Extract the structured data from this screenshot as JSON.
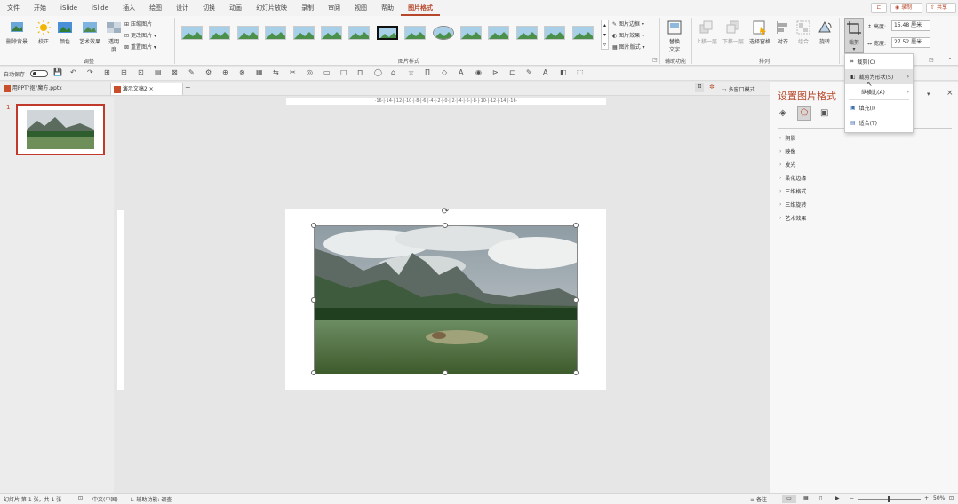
{
  "menu_tabs": [
    "文件",
    "开始",
    "iSlide",
    "iSlide",
    "插入",
    "绘图",
    "设计",
    "切换",
    "动画",
    "幻灯片放映",
    "录制",
    "审阅",
    "视图",
    "帮助",
    "图片格式"
  ],
  "top_right": {
    "comment": "",
    "record": "录制",
    "share": "共享"
  },
  "ribbon": {
    "remove_bg": "删除背景",
    "correct": "校正",
    "color": "颜色",
    "art_effects": "艺术效果",
    "transparency_line1": "透明",
    "transparency_line2": "度",
    "compress": "压缩图片",
    "change_pic": "更改图片",
    "reset_pic": "重置图片",
    "group_adjust": "调整",
    "group_styles": "图片样式",
    "pic_border": "图片边框",
    "pic_effects": "图片效果",
    "pic_layout": "图片版式",
    "alt_text_line1": "替换",
    "alt_text_line2": "文字",
    "group_accessibility": "辅助功能",
    "bring_forward": "上移一层",
    "send_backward": "下移一层",
    "selection_pane": "选择窗格",
    "align": "对齐",
    "group": "组合",
    "rotate": "旋转",
    "group_arrange": "排列",
    "crop": "裁剪",
    "height_label": "高度:",
    "height_value": "15.48 厘米",
    "width_label": "宽度:",
    "width_value": "27.52 厘米"
  },
  "autosave": "自动保存",
  "doc_tabs": [
    "用PPT\"抠\"魔方.pptx",
    "演示文稿2"
  ],
  "multi_window": "多窗口模式",
  "crop_menu": {
    "items": [
      "裁剪(C)",
      "裁剪为形状(S)",
      "纵横比(A)",
      "填充(I)",
      "适合(T)"
    ]
  },
  "format_panel": {
    "title": "设置图片格式",
    "sections": [
      "阴影",
      "映像",
      "发光",
      "柔化边缘",
      "三维格式",
      "三维旋转",
      "艺术效果"
    ]
  },
  "thumbnail_number": "1",
  "ruler_h": "·16·|·14·|·12·|·10·|·8·|·6·|·4·|·2·|·0·|·2·|·4·|·6·|·8·|·10·|·12·|·14·|·16·",
  "status": {
    "slide_info": "幻灯片 第 1 张，共 1 张",
    "language": "中文(中国)",
    "accessibility": "辅助功能: 调查",
    "notes": "备注",
    "zoom": "50%"
  },
  "colors": {
    "accent": "#b7472a",
    "selection": "#c0392b"
  }
}
